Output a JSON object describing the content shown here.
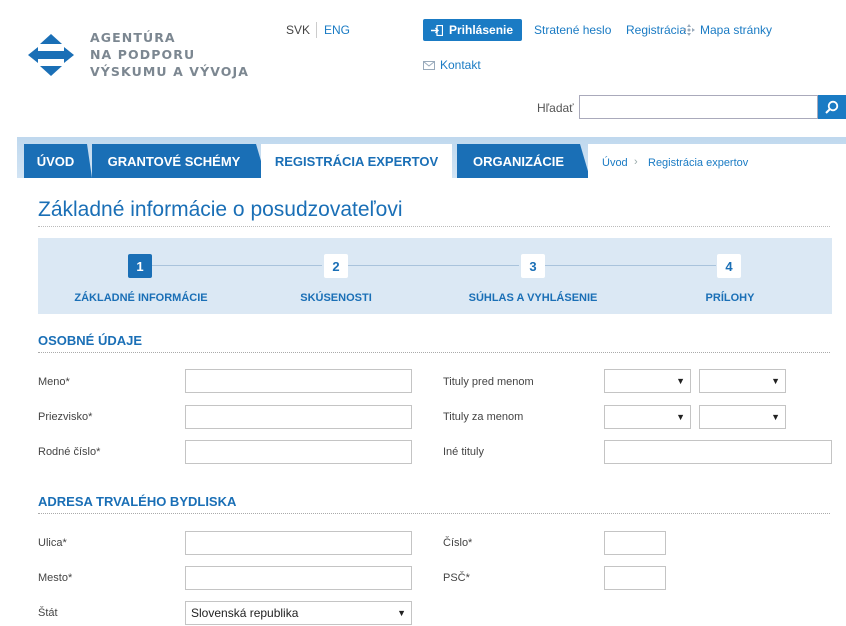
{
  "logo": {
    "lines": [
      "AGENTÚRA",
      "NA PODPORU",
      "VÝSKUMU A VÝVOJA"
    ]
  },
  "header": {
    "lang_svk": "SVK",
    "lang_eng": "ENG",
    "login": "Prihlásenie",
    "forgot_password": "Stratené heslo",
    "registration": "Registrácia",
    "sitemap": "Mapa stránky",
    "contact": "Kontakt",
    "search_label": "Hľadať",
    "search_value": ""
  },
  "nav": {
    "tabs": [
      "ÚVOD",
      "GRANTOVÉ SCHÉMY",
      "REGISTRÁCIA EXPERTOV",
      "ORGANIZÁCIE"
    ],
    "active_tab": "REGISTRÁCIA EXPERTOV",
    "breadcrumbs": [
      "Úvod",
      "Registrácia expertov"
    ],
    "breadcrumb_separator": "›"
  },
  "page_title": "Základné informácie o posudzovateľovi",
  "steps": [
    {
      "number": "1",
      "label": "ZÁKLADNÉ INFORMÁCIE",
      "active": true
    },
    {
      "number": "2",
      "label": "SKÚSENOSTI",
      "active": false
    },
    {
      "number": "3",
      "label": "SÚHLAS A VYHLÁSENIE",
      "active": false
    },
    {
      "number": "4",
      "label": "PRÍLOHY",
      "active": false
    }
  ],
  "personal": {
    "title": "OSOBNÉ ÚDAJE",
    "meno_label": "Meno*",
    "meno_value": "",
    "priezvisko_label": "Priezvisko*",
    "priezvisko_value": "",
    "rodne_cislo_label": "Rodné číslo*",
    "rodne_cislo_value": "",
    "tituly_pred_label": "Tituly pred menom",
    "tituly_pred_1": "",
    "tituly_pred_2": "",
    "tituly_za_label": "Tituly za menom",
    "tituly_za_1": "",
    "tituly_za_2": "",
    "ine_tituly_label": "Iné tituly",
    "ine_tituly_value": ""
  },
  "address": {
    "title": "ADRESA TRVALÉHO BYDLISKA",
    "ulica_label": "Ulica*",
    "ulica_value": "",
    "mesto_label": "Mesto*",
    "mesto_value": "",
    "stat_label": "Štát",
    "stat_value": "Slovenská republika",
    "cislo_label": "Číslo*",
    "cislo_value": "",
    "psc_label": "PSČ*",
    "psc_value": ""
  },
  "colors": {
    "brand_blue": "#1a6fb6",
    "link_blue": "#1a7bc4",
    "steps_bg": "#dbe8f4"
  }
}
